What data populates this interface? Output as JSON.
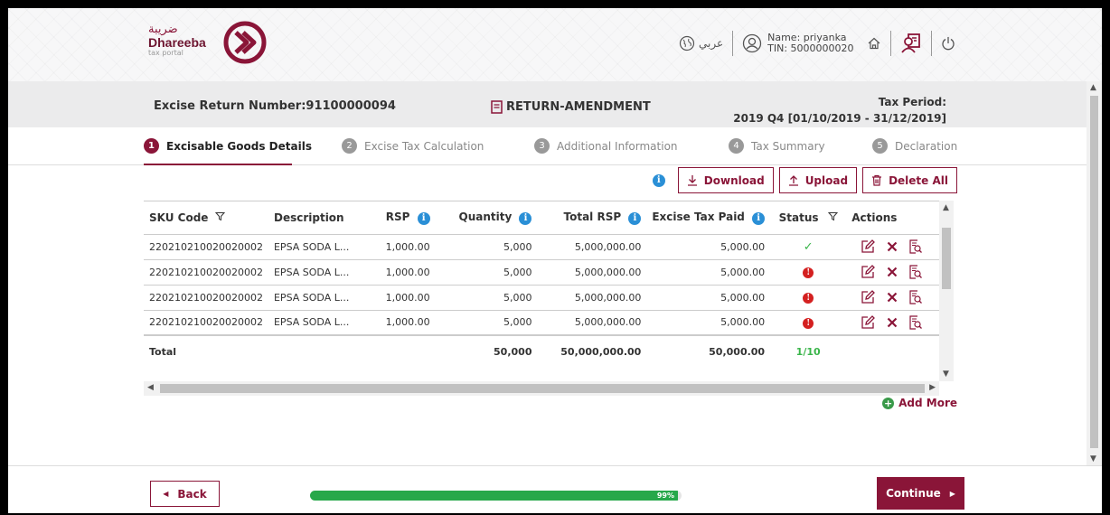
{
  "header": {
    "logo_ar": "ضريبة",
    "logo_en": "Dhareeba",
    "logo_sub": "tax portal",
    "language": "عربي",
    "user_name": "Name: priyanka",
    "user_tin": "TIN: 5000000020",
    "icons": [
      "globe-icon",
      "user-icon",
      "home-icon",
      "switch-profile-icon",
      "power-icon"
    ]
  },
  "return_bar": {
    "return_number": "Excise Return Number:91100000094",
    "return_type": "RETURN-AMENDMENT",
    "tax_period_label": "Tax Period:",
    "tax_period_value": "2019 Q4 [01/10/2019 - 31/12/2019]"
  },
  "steps": [
    {
      "num": "1",
      "label": "Excisable Goods Details",
      "active": true
    },
    {
      "num": "2",
      "label": "Excise Tax Calculation",
      "active": false
    },
    {
      "num": "3",
      "label": "Additional Information",
      "active": false
    },
    {
      "num": "4",
      "label": "Tax Summary",
      "active": false
    },
    {
      "num": "5",
      "label": "Declaration",
      "active": false
    }
  ],
  "toolbar": {
    "download": "Download",
    "upload": "Upload",
    "delete_all": "Delete All"
  },
  "table": {
    "headers": {
      "sku": "SKU Code",
      "description": "Description",
      "rsp": "RSP",
      "quantity": "Quantity",
      "total_rsp": "Total RSP",
      "excise_tax_paid": "Excise Tax Paid",
      "status": "Status",
      "actions": "Actions"
    },
    "rows": [
      {
        "sku": "220210210020020002",
        "description": "EPSA SODA L...",
        "rsp": "1,000.00",
        "quantity": "5,000",
        "total_rsp": "5,000,000.00",
        "tax": "5,000.00",
        "status": "ok"
      },
      {
        "sku": "220210210020020002",
        "description": "EPSA SODA L...",
        "rsp": "1,000.00",
        "quantity": "5,000",
        "total_rsp": "5,000,000.00",
        "tax": "5,000.00",
        "status": "error"
      },
      {
        "sku": "220210210020020002",
        "description": "EPSA SODA L...",
        "rsp": "1,000.00",
        "quantity": "5,000",
        "total_rsp": "5,000,000.00",
        "tax": "5,000.00",
        "status": "error"
      },
      {
        "sku": "220210210020020002",
        "description": "EPSA SODA L...",
        "rsp": "1,000.00",
        "quantity": "5,000",
        "total_rsp": "5,000,000.00",
        "tax": "5,000.00",
        "status": "error"
      }
    ],
    "total": {
      "label": "Total",
      "quantity": "50,000",
      "total_rsp": "50,000,000.00",
      "tax": "50,000.00",
      "status": "1/10"
    }
  },
  "add_more": "Add More",
  "footer": {
    "back": "Back",
    "progress_percent": 99,
    "progress_label": "99%",
    "continue": "Continue"
  },
  "colors": {
    "brand": "#8a1538",
    "success": "#27a84a",
    "info": "#2a8fd6",
    "error": "#d42020"
  }
}
